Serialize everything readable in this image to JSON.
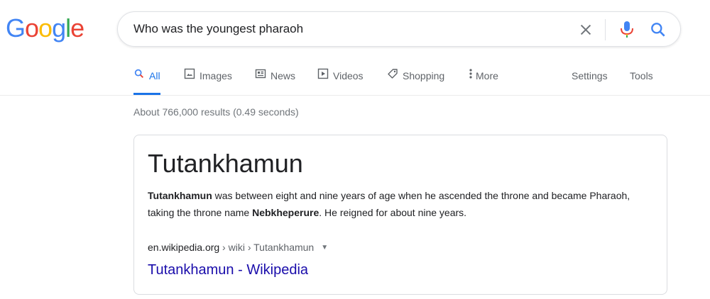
{
  "logo": {
    "letters": [
      "G",
      "o",
      "o",
      "g",
      "l",
      "e"
    ],
    "colors": [
      "#4285F4",
      "#EA4335",
      "#FBBC05",
      "#4285F4",
      "#34A853",
      "#EA4335"
    ]
  },
  "search": {
    "query": "Who was the youngest pharaoh",
    "icons": {
      "clear": "close-icon",
      "voice": "mic-icon",
      "submit": "search-icon"
    }
  },
  "tabs": {
    "all": "All",
    "images": "Images",
    "news": "News",
    "videos": "Videos",
    "shopping": "Shopping",
    "more": "More",
    "settings": "Settings",
    "tools": "Tools"
  },
  "results": {
    "stats": "About 766,000 results (0.49 seconds)"
  },
  "featured_snippet": {
    "title": "Tutankhamun",
    "text": {
      "part1_bold": "Tutankhamun",
      "part2": " was between eight and nine years of age when he ascended the throne and became Pharaoh, taking the throne name ",
      "part3_bold": "Nebkheperure",
      "part4": ". He reigned for about nine years."
    },
    "cite_domain": "en.wikipedia.org",
    "cite_path": " › wiki › Tutankhamun",
    "link_text": "Tutankhamun - Wikipedia"
  },
  "colors": {
    "accent": "#1a73e8",
    "link": "#1a0dab",
    "muted": "#70757a"
  }
}
